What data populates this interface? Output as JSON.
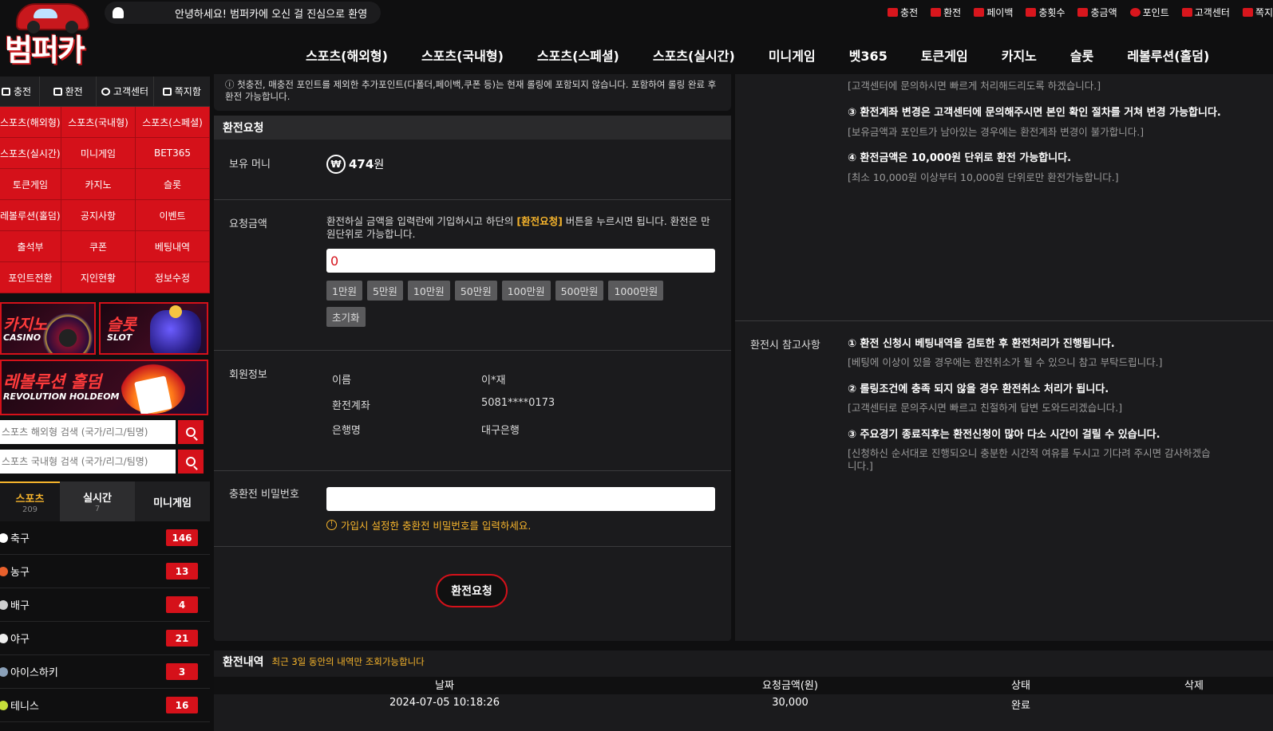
{
  "header": {
    "logo_text": "범퍼카",
    "ticker": "안녕하세요! 범퍼카에 오신 걸 진심으로 환영",
    "top_menu": [
      "충전",
      "환전",
      "페이백",
      "충횟수",
      "충금액",
      "포인트",
      "고객센터",
      "쪽지"
    ],
    "main_nav": [
      "스포츠(해외형)",
      "스포츠(국내형)",
      "스포츠(스페셜)",
      "스포츠(실시간)",
      "미니게임",
      "벳365",
      "토큰게임",
      "카지노",
      "슬롯",
      "레볼루션(홀덤)"
    ]
  },
  "sidebar": {
    "top_buttons": [
      "충전",
      "환전",
      "고객센터",
      "쪽지함"
    ],
    "grid": [
      "스포츠(해외형)",
      "스포츠(국내형)",
      "스포츠(스페셜)",
      "스포츠(실시간)",
      "미니게임",
      "BET365",
      "토큰게임",
      "카지노",
      "슬롯",
      "레볼루션(홀덤)",
      "공지사항",
      "이벤트",
      "출석부",
      "쿠폰",
      "베팅내역",
      "포인트전환",
      "지인현황",
      "정보수정"
    ],
    "banners": {
      "casino_ko": "카지노",
      "casino_en": "CASINO",
      "slot_ko": "슬롯",
      "slot_en": "SLOT",
      "holdem_ko": "레볼루션 홀덤",
      "holdem_en": "REVOLUTION HOLDEOM"
    },
    "search1_placeholder": "스포츠 해외형 검색 (국가/리그/팀명)",
    "search2_placeholder": "스포츠 국내형 검색 (국가/리그/팀명)",
    "tabs": [
      {
        "label": "스포츠",
        "count": "209"
      },
      {
        "label": "실시간",
        "count": "7"
      },
      {
        "label": "미니게임",
        "count": ""
      }
    ],
    "sports": [
      {
        "name": "축구",
        "count": "146",
        "color": "#ffffff"
      },
      {
        "name": "농구",
        "count": "13",
        "color": "#e8602c"
      },
      {
        "name": "배구",
        "count": "4",
        "color": "#cfcfcf"
      },
      {
        "name": "야구",
        "count": "21",
        "color": "#eeeeee"
      },
      {
        "name": "아이스하키",
        "count": "3",
        "color": "#8aa0b8"
      },
      {
        "name": "테니스",
        "count": "16",
        "color": "#c6e03a"
      }
    ]
  },
  "notice": "첫충전, 매충전 포인트를 제외한 추가포인트(다폴더,페이백,쿠폰 등)는 현재 롤링에 포함되지 않습니다. 포함하여 롤링 완료 후 환전 가능합니다.",
  "withdraw": {
    "title": "환전요청",
    "money_label": "보유 머니",
    "money_value": "474",
    "money_unit": "원",
    "amount_label": "요청금액",
    "amount_desc_pre": "환전하실 금액을 입력란에 기입하시고 하단의 ",
    "amount_desc_highlight": "[환전요청]",
    "amount_desc_post": " 버튼을 누르시면 됩니다. 환전은 만원단위로 가능합니다.",
    "amount_value": "0",
    "quick": [
      "1만원",
      "5만원",
      "10만원",
      "50만원",
      "100만원",
      "500만원",
      "1000만원"
    ],
    "reset": "초기화",
    "member_label": "회원정보",
    "name_label": "이름",
    "name_value": "이*재",
    "account_label": "환전계좌",
    "account_value": "5081****0173",
    "bank_label": "은행명",
    "bank_value": "대구은행",
    "pw_label": "충환전 비밀번호",
    "pw_hint": "가입시 설정한 충환전 비밀번호를 입력하세요.",
    "submit": "환전요청"
  },
  "right": {
    "top_lines": [
      {
        "t": "[고객센터에 문의하시면 빠르게 처리해드리도록 하겠습니다.]",
        "s": "s"
      },
      {
        "t": "③ 환전계좌 변경은 고객센터에 문의해주시면 본인 확인 절차를 거쳐 변경 가능합니다.",
        "s": "b"
      },
      {
        "t": "[보유금액과 포인트가 남아있는 경우에는 환전계좌 변경이 불가합니다.]",
        "s": "s"
      },
      {
        "t": "④ 환전금액은 10,000원 단위로 환전 가능합니다.",
        "s": "b"
      },
      {
        "t": "[최소 10,000원 이상부터 10,000원 단위로만 환전가능합니다.]",
        "s": "s"
      }
    ],
    "note_label": "환전시 참고사항",
    "notes": [
      {
        "t": "① 환전 신청시 베팅내역을 검토한 후 환전처리가 진행됩니다.",
        "s": "b"
      },
      {
        "t": "[베팅에 이상이 있을 경우에는 환전취소가 될 수 있으니 참고 부탁드립니다.]",
        "s": "s"
      },
      {
        "t": "② 롤링조건에 충족 되지 않을 경우 환전취소 처리가 됩니다.",
        "s": "b"
      },
      {
        "t": "[고객센터로 문의주시면 빠르고 친절하게 답변 도와드리겠습니다.]",
        "s": "s"
      },
      {
        "t": "③ 주요경기 종료직후는 환전신청이 많아 다소 시간이 걸릴 수 있습니다.",
        "s": "b"
      },
      {
        "t": "[신청하신 순서대로 진행되오니 충분한 시간적 여유를 두시고 기다려 주시면 감사하겠습",
        "s": "s"
      },
      {
        "t": "니다.]",
        "s": "s"
      }
    ]
  },
  "history": {
    "title": "환전내역",
    "subtitle": "최근 3일 동안의 내역만 조회가능합니다",
    "columns": [
      "날짜",
      "요청금액(원)",
      "상태",
      "삭제"
    ],
    "rows": [
      {
        "date": "2024-07-05 10:18:26",
        "amount": "30,000",
        "status": "완료"
      }
    ]
  },
  "colors": {
    "accent": "#d5111a",
    "highlight": "#f7b52c",
    "bg": "#0f0f10",
    "panel": "#1b1b1d"
  }
}
